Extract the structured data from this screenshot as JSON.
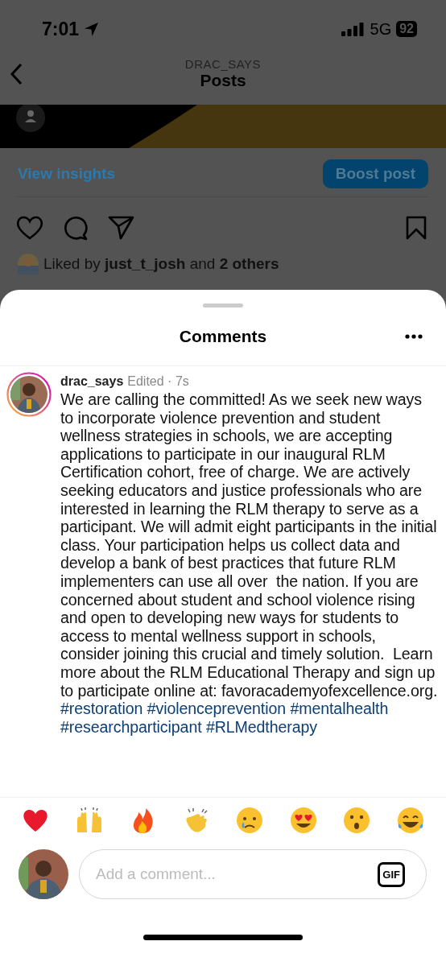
{
  "status_bar": {
    "time": "7:01",
    "network": "5G",
    "battery": "92"
  },
  "header": {
    "account": "DRAC_SAYS",
    "title": "Posts"
  },
  "post": {
    "insights_link": "View insights",
    "boost_button": "Boost post",
    "liked_by": {
      "prefix": "Liked by",
      "user": "just_t_josh",
      "middle": "and",
      "others": "2 others"
    }
  },
  "comments_sheet": {
    "title": "Comments",
    "comment": {
      "username": "drac_says",
      "meta": "Edited · 7s",
      "text": "We are calling the committed! As we seek new ways to incorporate violence prevention and student wellness strategies in schools, we are accepting applications to participate in our inaugural RLM Certification cohort, free of charge. We are actively seeking educators and justice professionals who are interested in learning the RLM therapy to serve as a participant. We will admit eight participants in the initial class. Your participation helps us collect data and develop a bank of best practices that future RLM implementers can use all over  the nation. If you are concerned about student and school violence rising and open to developing new ways for students to access to mental wellness support in schools, consider joining this crucial and timely solution.  Learn more about the RLM Educational Therapy and sign up to participate online at: favoracademyofexcellence.org.",
      "hashtags": [
        "#restoration",
        "#violenceprevention",
        "#mentalhealth",
        "#researchparticipant",
        "#RLMedtherapy"
      ]
    },
    "input": {
      "placeholder": "Add a comment...",
      "gif_button": "GIF"
    }
  }
}
